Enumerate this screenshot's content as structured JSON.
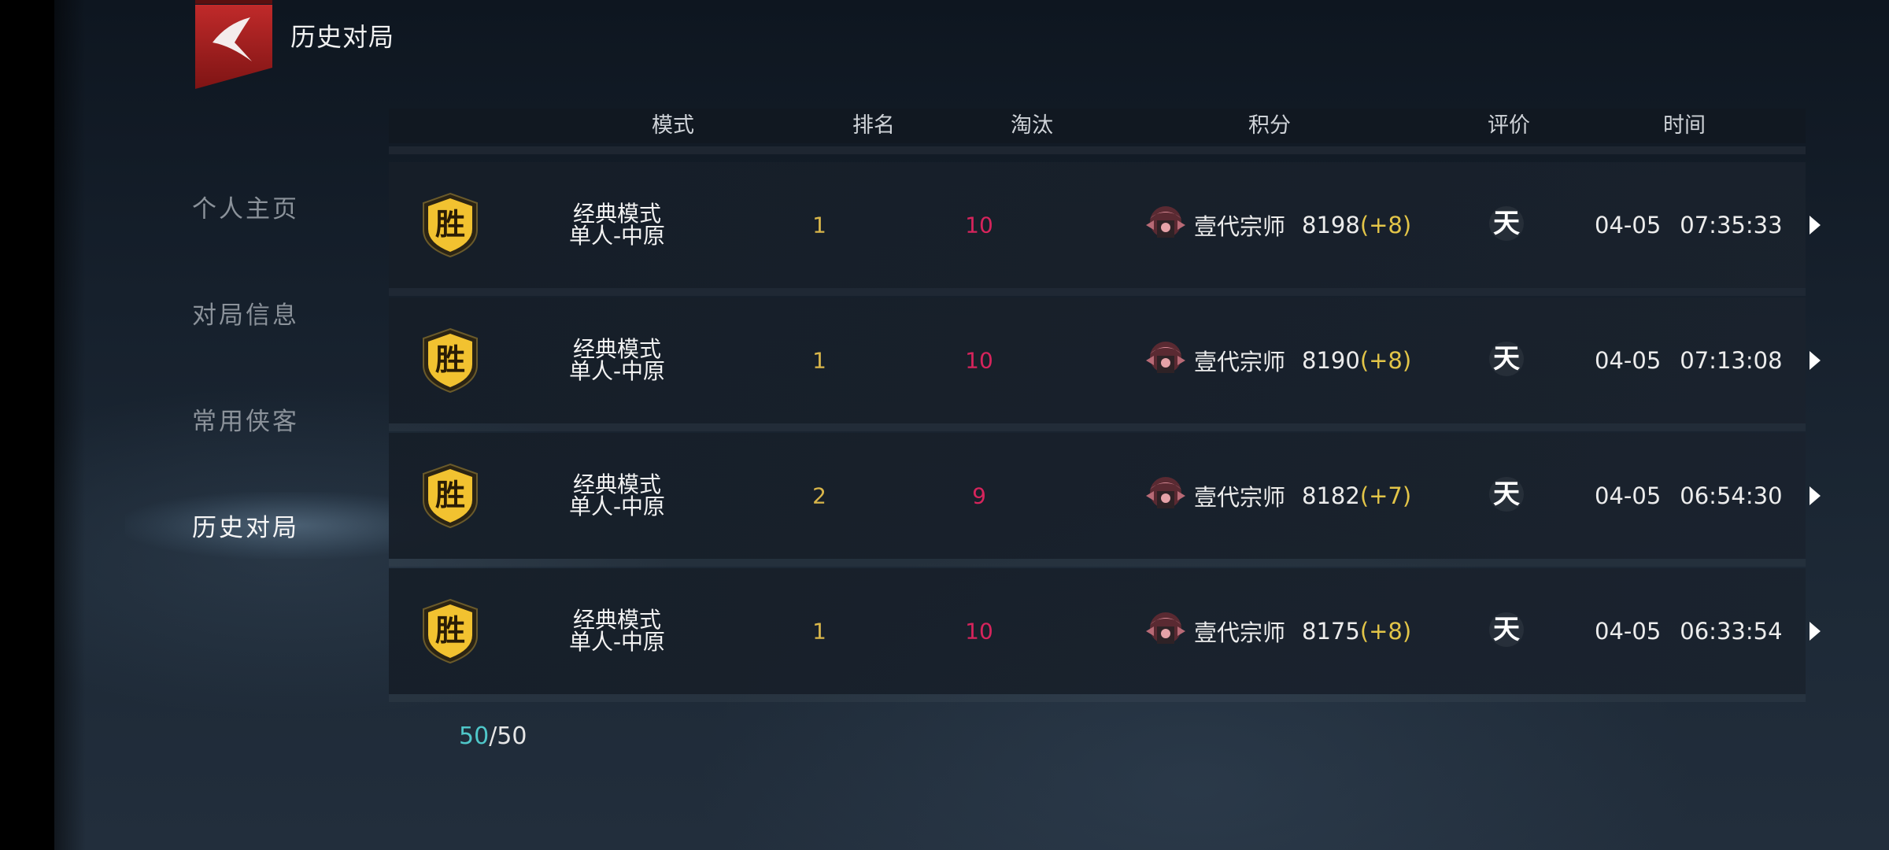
{
  "header": {
    "title": "历史对局"
  },
  "sidebar": {
    "items": [
      {
        "label": "个人主页",
        "active": false
      },
      {
        "label": "对局信息",
        "active": false
      },
      {
        "label": "常用侠客",
        "active": false
      },
      {
        "label": "历史对局",
        "active": true
      }
    ]
  },
  "table": {
    "columns": [
      "模式",
      "排名",
      "淘汰",
      "积分",
      "评价",
      "时间"
    ],
    "rows": [
      {
        "result": "胜",
        "mode": "经典模式",
        "submode": "单人-中原",
        "rank": "1",
        "kills": "10",
        "tier": "壹代宗师",
        "score": "8198",
        "delta": "(+8)",
        "rating": "天",
        "date": "04-05",
        "time": "07:35:33"
      },
      {
        "result": "胜",
        "mode": "经典模式",
        "submode": "单人-中原",
        "rank": "1",
        "kills": "10",
        "tier": "壹代宗师",
        "score": "8190",
        "delta": "(+8)",
        "rating": "天",
        "date": "04-05",
        "time": "07:13:08"
      },
      {
        "result": "胜",
        "mode": "经典模式",
        "submode": "单人-中原",
        "rank": "2",
        "kills": "9",
        "tier": "壹代宗师",
        "score": "8182",
        "delta": "(+7)",
        "rating": "天",
        "date": "04-05",
        "time": "06:54:30"
      },
      {
        "result": "胜",
        "mode": "经典模式",
        "submode": "单人-中原",
        "rank": "1",
        "kills": "10",
        "tier": "壹代宗师",
        "score": "8175",
        "delta": "(+8)",
        "rating": "天",
        "date": "04-05",
        "time": "06:33:54"
      }
    ]
  },
  "pagination": {
    "current": "50",
    "separator": "/",
    "total": "50"
  },
  "colors": {
    "accent_teal": "#4fc7c9",
    "rank_gold": "#d9b64a",
    "kills_red": "#d6245c",
    "delta_gold": "#e3c548",
    "badge_gold": "#f2c230"
  },
  "icons": {
    "back": "back-arrow-icon",
    "row_arrow": "play-arrow-icon",
    "tier": "tier-emblem-icon",
    "result": "win-badge-icon"
  }
}
